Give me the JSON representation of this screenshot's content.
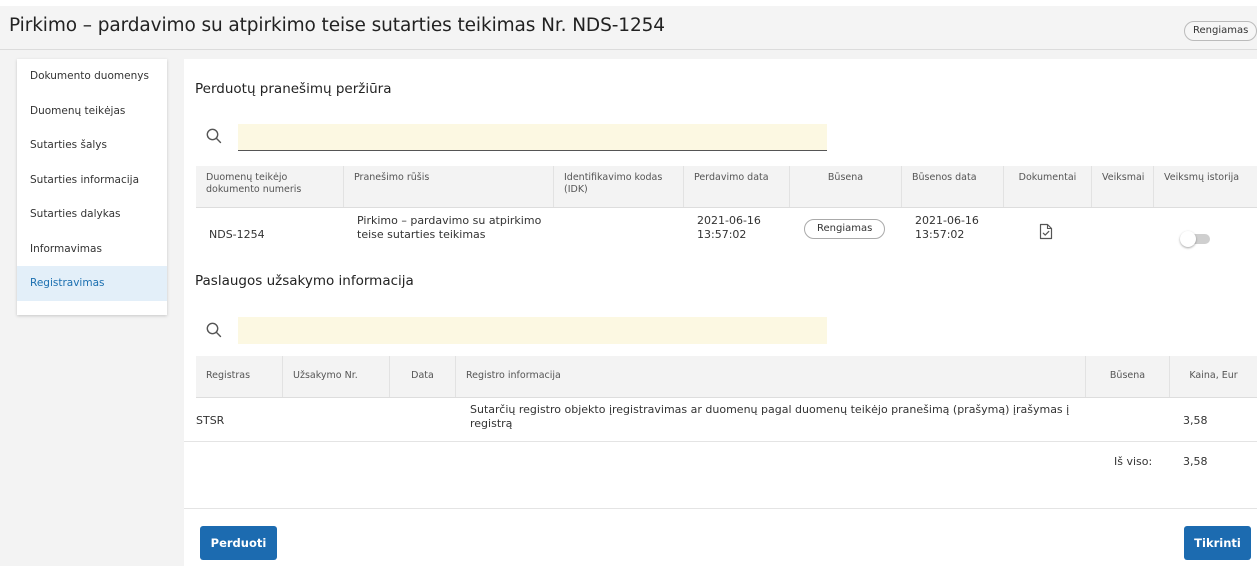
{
  "header": {
    "title": "Pirkimo – pardavimo su atpirkimo teise sutarties teikimas Nr. NDS-1254",
    "status": "Rengiamas"
  },
  "sidebar": {
    "items": [
      {
        "label": "Dokumento duomenys"
      },
      {
        "label": "Duomenų teikėjas"
      },
      {
        "label": "Sutarties šalys"
      },
      {
        "label": "Sutarties informacija"
      },
      {
        "label": "Sutarties dalykas"
      },
      {
        "label": "Informavimas"
      },
      {
        "label": "Registravimas"
      }
    ],
    "active_index": 6
  },
  "messages": {
    "title": "Perduotų pranešimų peržiūra",
    "search": {
      "value": "",
      "placeholder": ""
    },
    "columns": [
      "Duomenų teikėjo dokumento numeris",
      "Pranešimo rūšis",
      "Identifikavimo kodas (IDK)",
      "Perdavimo data",
      "Būsena",
      "Būsenos data",
      "Dokumentai",
      "Veiksmai",
      "Veiksmų istorija"
    ],
    "rows": [
      {
        "doc_number": "NDS-1254",
        "type": "Pirkimo – pardavimo su atpirkimo teise sutarties teikimas",
        "idk": "",
        "transfer_date": "2021-06-16",
        "transfer_time": "13:57:02",
        "status": "Rengiamas",
        "status_date": "2021-06-16",
        "status_time": "13:57:02",
        "document_icon": "document-check-icon",
        "history_toggle": false
      }
    ]
  },
  "order": {
    "title": "Paslaugos užsakymo informacija",
    "search": {
      "value": "",
      "placeholder": ""
    },
    "columns": [
      "Registras",
      "Užsakymo Nr.",
      "Data",
      "Registro informacija",
      "Būsena",
      "Kaina, Eur"
    ],
    "rows": [
      {
        "registry": "STSR",
        "order_no": "",
        "date": "",
        "info": "Sutarčių registro objekto įregistravimas ar duomenų pagal duomenų teikėjo pranešimą (prašymą) įrašymas į registrą",
        "status": "",
        "price": "3,58"
      }
    ],
    "total_label": "Iš viso:",
    "total_value": "3,58"
  },
  "actions": {
    "submit_label": "Perduoti",
    "check_label": "Tikrinti"
  },
  "colors": {
    "primary": "#1c6bb0",
    "search_bg": "#fcf8e2",
    "active_nav_bg": "#e3eff9",
    "teal_text": "#17b3b3"
  }
}
